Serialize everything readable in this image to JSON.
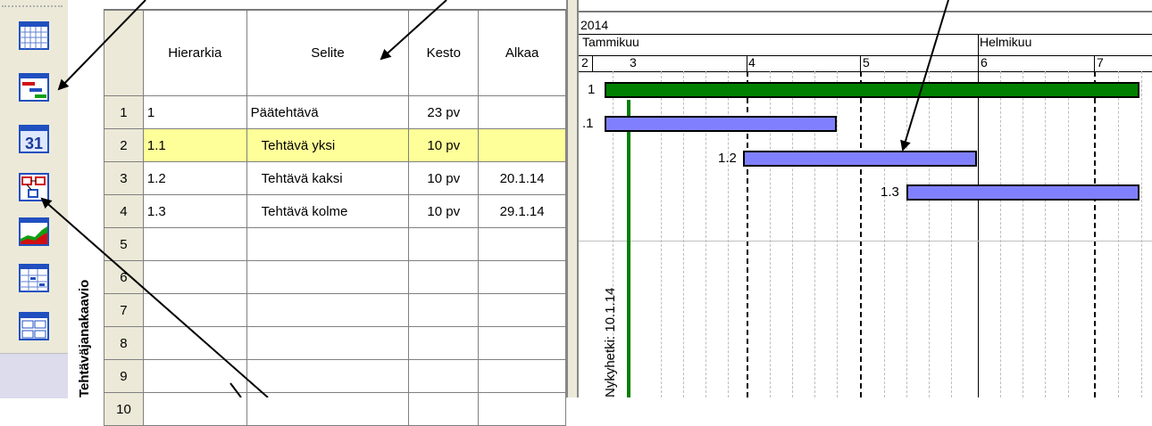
{
  "sidebar": {
    "vertical_label": "Tehtäväjanakaavio",
    "buttons": [
      {
        "icon": "calendar-grid-icon"
      },
      {
        "icon": "gantt-chart-icon"
      },
      {
        "icon": "calendar-31-icon"
      },
      {
        "icon": "network-diagram-icon"
      },
      {
        "icon": "resource-graph-icon"
      },
      {
        "icon": "task-usage-icon"
      },
      {
        "icon": "tracking-gantt-icon"
      }
    ],
    "calendar_number": "31"
  },
  "table": {
    "columns": [
      "Hierarkia",
      "Selite",
      "Kesto",
      "Alkaa"
    ],
    "rows": [
      {
        "num": "1",
        "hierarchy": "1",
        "name": "Päätehtävä",
        "duration": "23 pv",
        "start": ""
      },
      {
        "num": "2",
        "hierarchy": "1.1",
        "name": "Tehtävä yksi",
        "duration": "10 pv",
        "start": ""
      },
      {
        "num": "3",
        "hierarchy": "1.2",
        "name": "Tehtävä kaksi",
        "duration": "10 pv",
        "start": "20.1.14"
      },
      {
        "num": "4",
        "hierarchy": "1.3",
        "name": "Tehtävä kolme",
        "duration": "10 pv",
        "start": "29.1.14"
      },
      {
        "num": "5",
        "hierarchy": "",
        "name": "",
        "duration": "",
        "start": ""
      },
      {
        "num": "6",
        "hierarchy": "",
        "name": "",
        "duration": "",
        "start": ""
      },
      {
        "num": "7",
        "hierarchy": "",
        "name": "",
        "duration": "",
        "start": ""
      },
      {
        "num": "8",
        "hierarchy": "",
        "name": "",
        "duration": "",
        "start": ""
      },
      {
        "num": "9",
        "hierarchy": "",
        "name": "",
        "duration": "",
        "start": ""
      },
      {
        "num": "10",
        "hierarchy": "",
        "name": "",
        "duration": "",
        "start": ""
      }
    ],
    "selected_row": "2"
  },
  "gantt": {
    "year": "2014",
    "months": [
      "Tammikuu",
      "Helmikuu"
    ],
    "weeks": [
      "2",
      "3",
      "4",
      "5",
      "6",
      "7"
    ],
    "bars": [
      {
        "label": "1",
        "color": "#008000"
      },
      {
        "label": ".1",
        "color": "#8080ff"
      },
      {
        "label": "1.2",
        "color": "#8080ff"
      },
      {
        "label": "1.3",
        "color": "#8080ff"
      }
    ],
    "today_label": "Nykyhetki: 10.1.14",
    "today_color": "#008000"
  }
}
